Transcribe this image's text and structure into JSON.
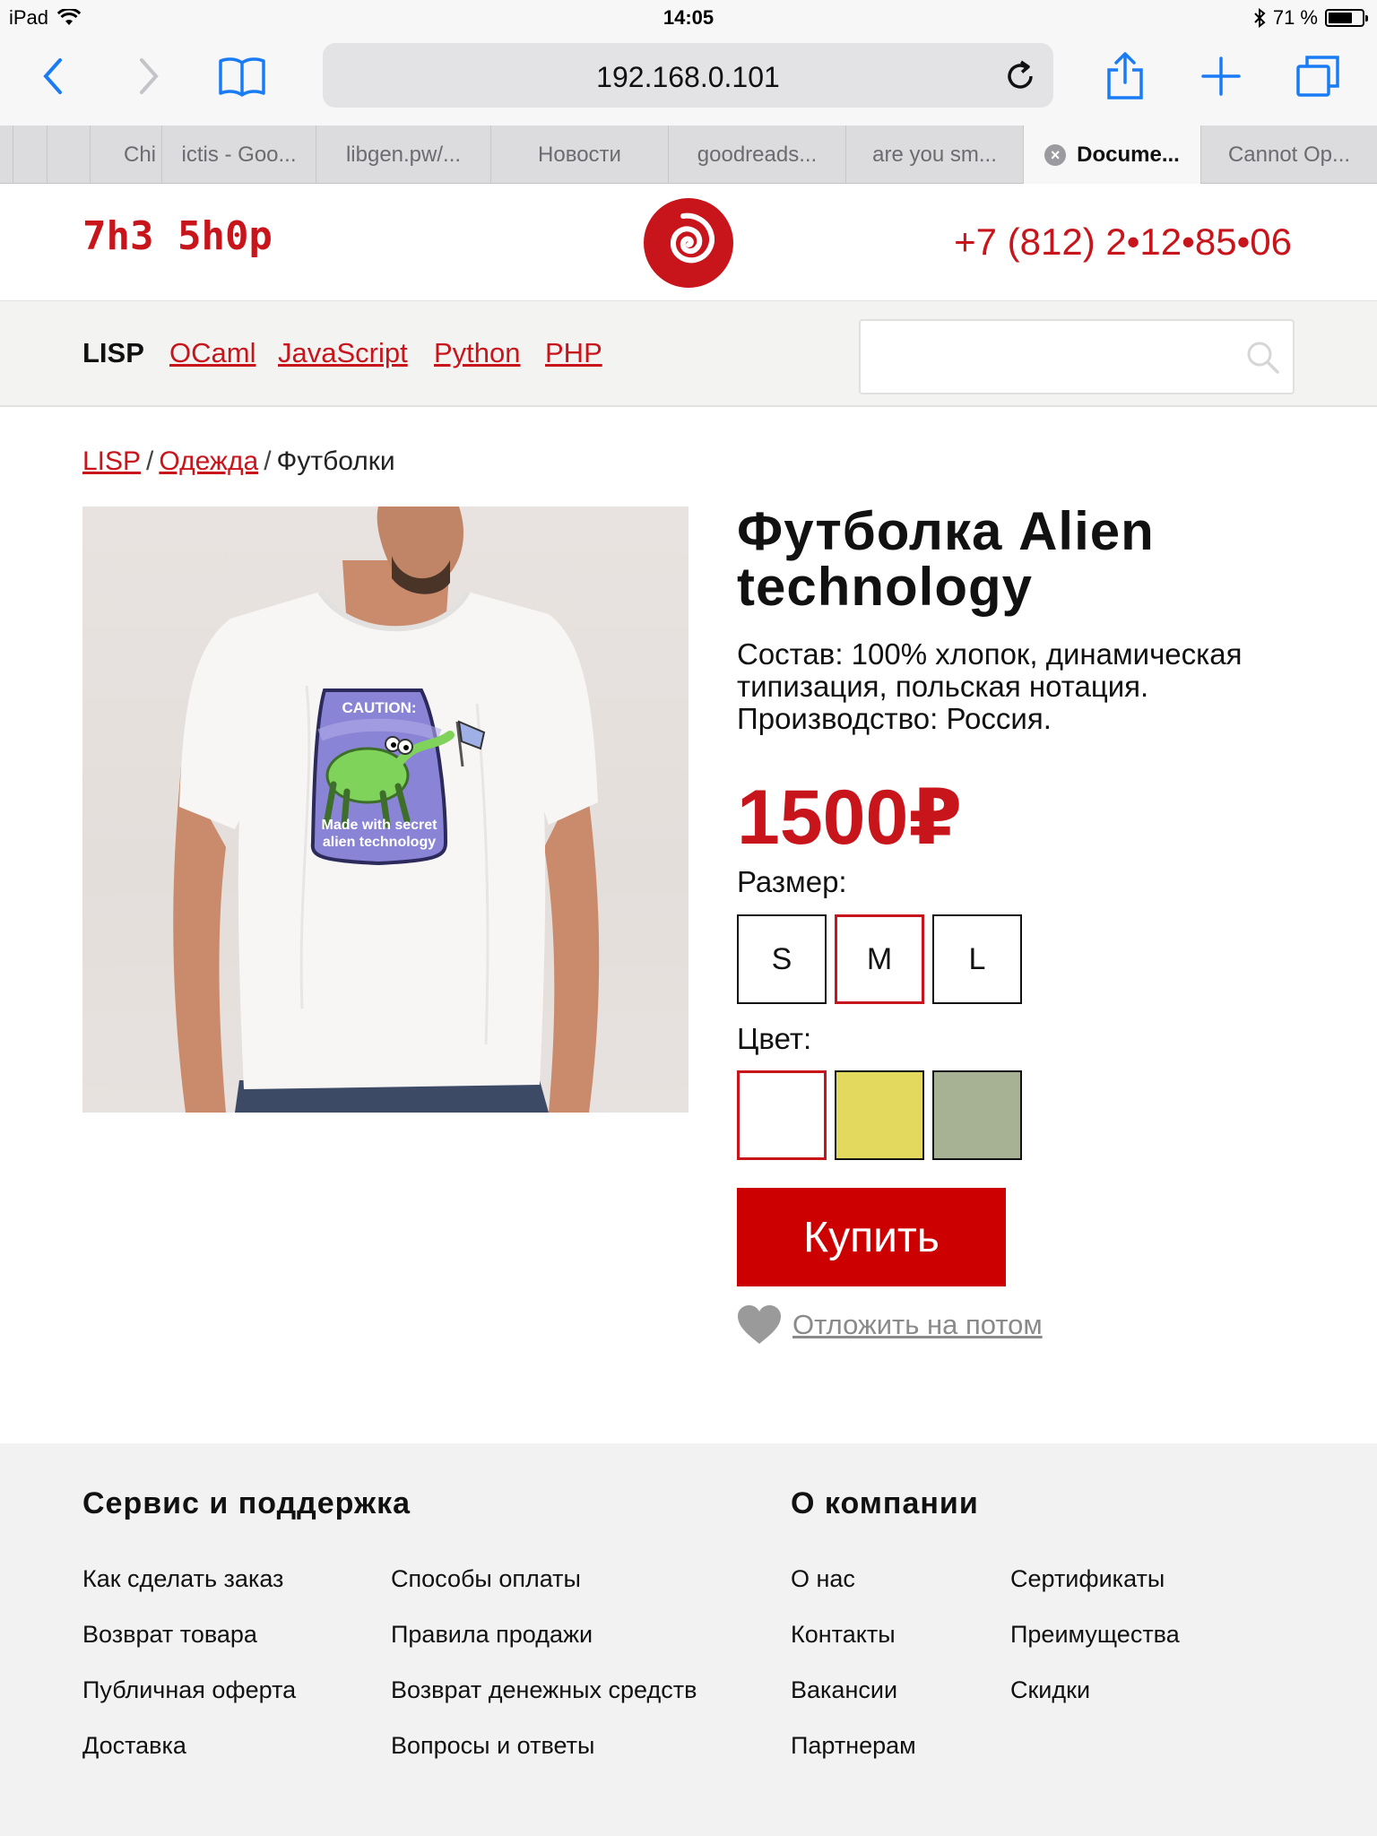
{
  "status_bar": {
    "device": "iPad",
    "time": "14:05",
    "battery_percent": "71 %",
    "battery_level": 0.71
  },
  "browser": {
    "url": "192.168.0.101",
    "icons": [
      "back-icon",
      "forward-icon",
      "bookmarks-icon",
      "reload-icon",
      "share-icon",
      "new-tab-icon",
      "tabs-icon"
    ],
    "tabs": [
      {
        "label": "",
        "active": false
      },
      {
        "label": "",
        "active": false
      },
      {
        "label": "Chi",
        "active": false
      },
      {
        "label": "ictis - Goo...",
        "active": false
      },
      {
        "label": "libgen.pw/...",
        "active": false
      },
      {
        "label": "Новости",
        "active": false
      },
      {
        "label": "goodreads...",
        "active": false
      },
      {
        "label": "are you sm...",
        "active": false
      },
      {
        "label": "Docume...",
        "active": true
      },
      {
        "label": "Cannot Op...",
        "active": false
      }
    ]
  },
  "header": {
    "logo_text": "7h3 5h0p",
    "phone": "+7 (812) 2•12•85•06",
    "brand_color": "#c8141b"
  },
  "nav": {
    "categories": [
      {
        "label": "LISP",
        "current": true
      },
      {
        "label": "OCaml",
        "current": false
      },
      {
        "label": "JavaScript",
        "current": false
      },
      {
        "label": "Python",
        "current": false
      },
      {
        "label": "PHP",
        "current": false
      }
    ],
    "search_value": ""
  },
  "breadcrumb": [
    {
      "label": "LISP",
      "link": true
    },
    {
      "label": "Одежда",
      "link": true
    },
    {
      "label": "Футболки",
      "link": false
    }
  ],
  "product": {
    "title": "Футболка Alien technology",
    "description": "Состав: 100% хлопок, динамическая типизация, польская нотация. Производство: Россия.",
    "price": "1500₽",
    "shirt_print": {
      "caution": "CAUTION:",
      "line1": "Made with secret",
      "line2": "alien technology"
    },
    "size_label": "Размер:",
    "sizes": [
      {
        "label": "S",
        "selected": false
      },
      {
        "label": "M",
        "selected": true
      },
      {
        "label": "L",
        "selected": false
      }
    ],
    "color_label": "Цвет:",
    "colors": [
      {
        "value": "#ffffff",
        "selected": true
      },
      {
        "value": "#e3d95e",
        "selected": false
      },
      {
        "value": "#a7b295",
        "selected": false
      }
    ],
    "buy_label": "Купить",
    "wishlist_label": "Отложить на потом"
  },
  "footer": {
    "columns": [
      {
        "heading": "Сервис и поддержка",
        "col_a": [
          "Как сделать заказ",
          "Возврат товара",
          "Публичная оферта",
          "Доставка"
        ],
        "col_b": [
          "Способы оплаты",
          "Правила продажи",
          "Возврат денежных средств",
          "Вопросы и ответы"
        ]
      },
      {
        "heading": "О компании",
        "col_a": [
          "О нас",
          "Контакты",
          "Вакансии",
          "Партнерам"
        ],
        "col_b": [
          "Сертификаты",
          "Преимущества",
          "Скидки"
        ]
      }
    ]
  }
}
